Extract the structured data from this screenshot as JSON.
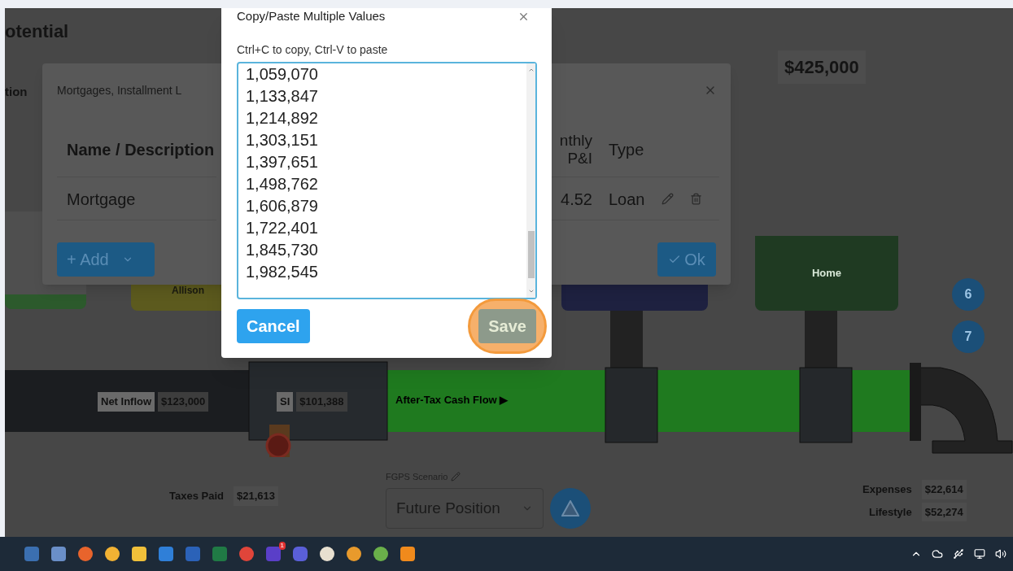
{
  "background": {
    "heading": "otential",
    "side_label": "tion",
    "tank_value": "$425,000",
    "tanks": [
      {
        "label": "Allison",
        "color": "#5c5a1e"
      },
      {
        "label": "Home",
        "color": "#1f3a22"
      }
    ],
    "pipe": {
      "net_inflow": {
        "label": "Net Inflow",
        "value": "$123,000"
      },
      "si": {
        "label": "SI",
        "value": "$101,388"
      },
      "flow_label": "After-Tax Cash Flow ▶"
    },
    "taxes": {
      "label": "Taxes Paid",
      "value": "$21,613"
    },
    "scenario": {
      "label": "FGPS Scenario",
      "value": "Future Position"
    },
    "steps": [
      "6",
      "7"
    ],
    "totals": [
      {
        "label": "Expenses",
        "value": "$22,614"
      },
      {
        "label": "Lifestyle",
        "value": "$52,274"
      }
    ]
  },
  "loans_dialog": {
    "title": "Mortgages, Installment L",
    "columns": [
      "Name / Description",
      "nthly P&I",
      "Type"
    ],
    "rows": [
      {
        "name": "Mortgage",
        "payment": "4.52",
        "type": "Loan"
      }
    ],
    "add_button": "+ Add",
    "ok_button": "Ok"
  },
  "paste_dialog": {
    "title": "Copy/Paste Multiple Values",
    "hint": "Ctrl+C to copy, Ctrl-V to paste",
    "values": [
      "1,059,070",
      "1,133,847",
      "1,214,892",
      "1,303,151",
      "1,397,651",
      "1,498,762",
      "1,606,879",
      "1,722,401",
      "1,845,730",
      "1,982,545"
    ],
    "buttons": [
      {
        "label": "Cancel",
        "kind": "primary",
        "highlighted": false
      },
      {
        "label": "Save",
        "kind": "muted",
        "highlighted": true
      }
    ]
  },
  "taskbar": {
    "badge": "1"
  }
}
